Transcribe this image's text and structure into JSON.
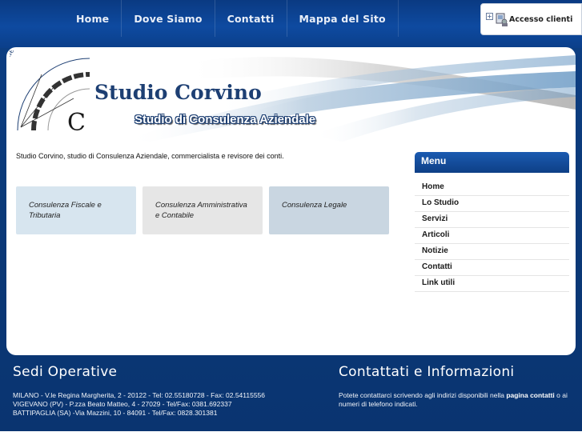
{
  "nav": {
    "items": [
      {
        "label": "Home"
      },
      {
        "label": "Dove Siamo"
      },
      {
        "label": "Contatti"
      },
      {
        "label": "Mappa del Sito"
      }
    ]
  },
  "client_access": {
    "label": "Accesso clienti"
  },
  "header": {
    "title": "Studio Corvino",
    "subtitle": "Studio di Consulenza Aziendale",
    "logo_text": "Studio Consulenza Aziendale",
    "logo_letter": "C"
  },
  "intro": {
    "text": "Studio Corvino, studio di Consulenza Aziendale, commercialista e revisore dei conti."
  },
  "services": [
    {
      "label": "Consulenza Fiscale e Tributaria"
    },
    {
      "label": "Consulenza Amministrativa e Contabile"
    },
    {
      "label": "Consulenza Legale"
    }
  ],
  "menu": {
    "title": "Menu",
    "items": [
      {
        "label": "Home"
      },
      {
        "label": "Lo Studio"
      },
      {
        "label": "Servizi"
      },
      {
        "label": "Articoli"
      },
      {
        "label": "Notizie"
      },
      {
        "label": "Contatti"
      },
      {
        "label": "Link utili"
      }
    ]
  },
  "footer": {
    "left_title": "Sedi Operative",
    "addresses": [
      "MILANO - V.le Regina Margherita, 2 - 20122 - Tel: 02.55180728 - Fax: 02.54115556",
      "VIGEVANO (PV) - P.zza Beato Matteo, 4 - 27029 - Tel/Fax: 0381.692337",
      "BATTIPAGLIA (SA) -Via Mazzini, 10 - 84091 - Tel/Fax: 0828.301381"
    ],
    "right_title": "Contattati e Informazioni",
    "contact_pre": "Potete contattarci scrivendo agli indirizi disponibili nella ",
    "contact_link": "pagina contatti",
    "contact_post": " o ai numeri di telefono indicati."
  },
  "colors": {
    "brand_blue": "#0b3a7a",
    "menu_blue": "#1b5bb1",
    "title_navy": "#1d3f73"
  }
}
